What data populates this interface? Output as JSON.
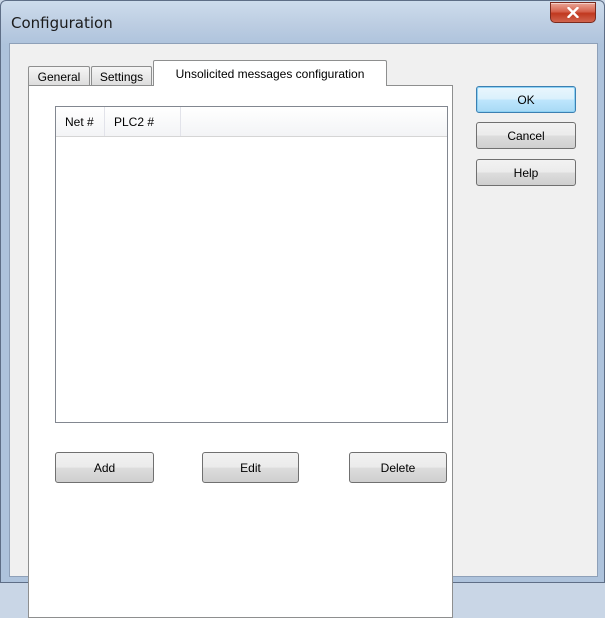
{
  "window": {
    "title": "Configuration"
  },
  "tabs": [
    {
      "label": "General",
      "active": false
    },
    {
      "label": "Settings",
      "active": false
    },
    {
      "label": "Unsolicited messages configuration",
      "active": true
    }
  ],
  "list": {
    "columns": [
      "Net #",
      "PLC2 #"
    ],
    "rows": []
  },
  "panel_buttons": {
    "add": "Add",
    "edit": "Edit",
    "delete": "Delete"
  },
  "dialog_buttons": {
    "ok": "OK",
    "cancel": "Cancel",
    "help": "Help"
  },
  "icons": {
    "close": "close-icon"
  },
  "colors": {
    "close_button": "#c7432c",
    "default_button_border": "#3c7fb1"
  }
}
